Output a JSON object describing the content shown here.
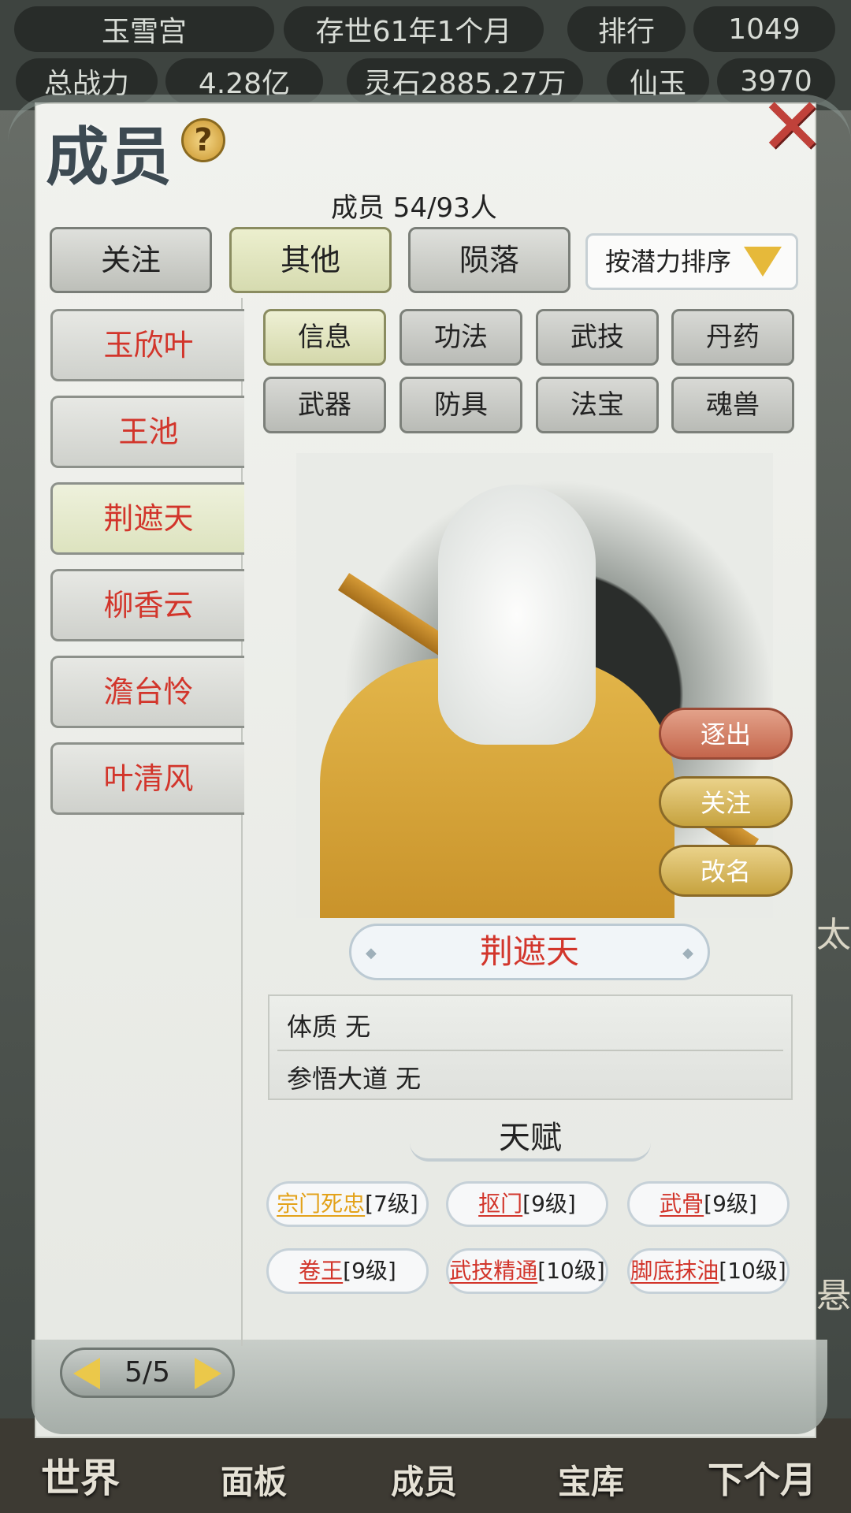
{
  "topbar": {
    "sect_name": "玉雪宫",
    "age": "存世61年1个月",
    "rank_label": "排行",
    "rank_value": "1049",
    "power_label": "总战力",
    "power_value": "4.28亿",
    "spirit_stone": "灵石2885.27万",
    "jade_label": "仙玉",
    "jade_value": "3970"
  },
  "panel": {
    "title": "成员",
    "help": "?",
    "close": "✕",
    "member_count": "成员 54/93人",
    "tabs": [
      {
        "label": "关注"
      },
      {
        "label": "其他"
      },
      {
        "label": "陨落"
      }
    ],
    "sort": {
      "label": "按潜力排序"
    },
    "members": [
      {
        "name": "玉欣叶"
      },
      {
        "name": "王池"
      },
      {
        "name": "荆遮天"
      },
      {
        "name": "柳香云"
      },
      {
        "name": "澹台怜"
      },
      {
        "name": "叶清风"
      }
    ],
    "subtabs": [
      {
        "label": "信息"
      },
      {
        "label": "功法"
      },
      {
        "label": "武技"
      },
      {
        "label": "丹药"
      },
      {
        "label": "武器"
      },
      {
        "label": "防具"
      },
      {
        "label": "法宝"
      },
      {
        "label": "魂兽"
      }
    ],
    "actions": {
      "evict": "逐出",
      "follow": "关注",
      "rename": "改名"
    },
    "selected_name": "荆遮天",
    "info": {
      "constitution": "体质 无",
      "dao": "参悟大道 无"
    },
    "talent_title": "天赋",
    "talents": [
      {
        "name": "宗门死忠",
        "level": "[7级]"
      },
      {
        "name": "抠门",
        "level": "[9级]"
      },
      {
        "name": "武骨",
        "level": "[9级]"
      },
      {
        "name": "卷王",
        "level": "[9级]"
      },
      {
        "name": "武技精通",
        "level": "[10级]"
      },
      {
        "name": "脚底抹油",
        "level": "[10级]"
      }
    ],
    "pager": "5/5"
  },
  "bottom_nav": [
    {
      "label": "世界"
    },
    {
      "label": "面板"
    },
    {
      "label": "成员"
    },
    {
      "label": "宝库"
    },
    {
      "label": "下个月"
    }
  ],
  "side_peek": {
    "right_1": "太",
    "right_2": "悬"
  },
  "colors": {
    "accent_red": "#d2352b",
    "gold": "#e3a21a",
    "panel_bg": "#eeefeb"
  }
}
